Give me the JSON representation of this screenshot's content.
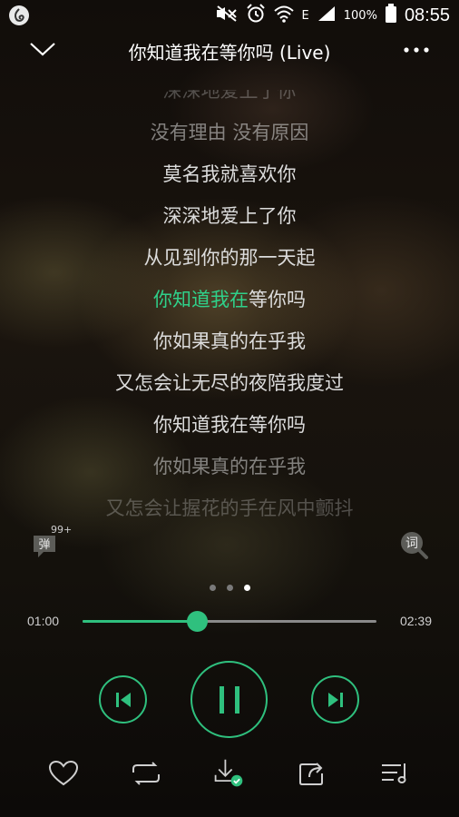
{
  "status_bar": {
    "battery": "100%",
    "time": "08:55",
    "network": "E",
    "icons": [
      "app-icon",
      "mute-icon",
      "alarm-icon",
      "wifi-icon",
      "signal-icon",
      "battery-icon"
    ]
  },
  "header": {
    "title": "你知道我在等你吗 (Live)",
    "back_icon": "chevron-down-icon",
    "more_icon": "more-dots-icon"
  },
  "lyrics": {
    "lines": [
      {
        "text": "深深地爱上了你"
      },
      {
        "text": "没有理由 没有原因"
      },
      {
        "text": "莫名我就喜欢你"
      },
      {
        "text": "深深地爱上了你"
      },
      {
        "text": "从见到你的那一天起"
      },
      {
        "text_hl": "你知道我在",
        "text_rest": "等你吗"
      },
      {
        "text": "你如果真的在乎我"
      },
      {
        "text": "又怎会让无尽的夜陪我度过"
      },
      {
        "text": "你知道我在等你吗"
      },
      {
        "text": "你如果真的在乎我"
      },
      {
        "text": "又怎会让握花的手在风中颤抖"
      }
    ]
  },
  "danmu": {
    "label": "弹",
    "badge": "99+"
  },
  "lyric_mode": {
    "label": "词"
  },
  "pager": {
    "pages": 3,
    "active": 3
  },
  "progress": {
    "elapsed": "01:00",
    "total": "02:39",
    "fraction": 0.39
  },
  "controls": {
    "prev_icon": "skip-previous-icon",
    "play_icon": "pause-icon",
    "next_icon": "skip-next-icon"
  },
  "toolbar": {
    "icons": [
      "heart-icon",
      "repeat-icon",
      "download-icon",
      "share-icon",
      "playlist-icon"
    ]
  },
  "colors": {
    "accent": "#2fc07e",
    "lyric_highlight": "#2fd18a"
  }
}
